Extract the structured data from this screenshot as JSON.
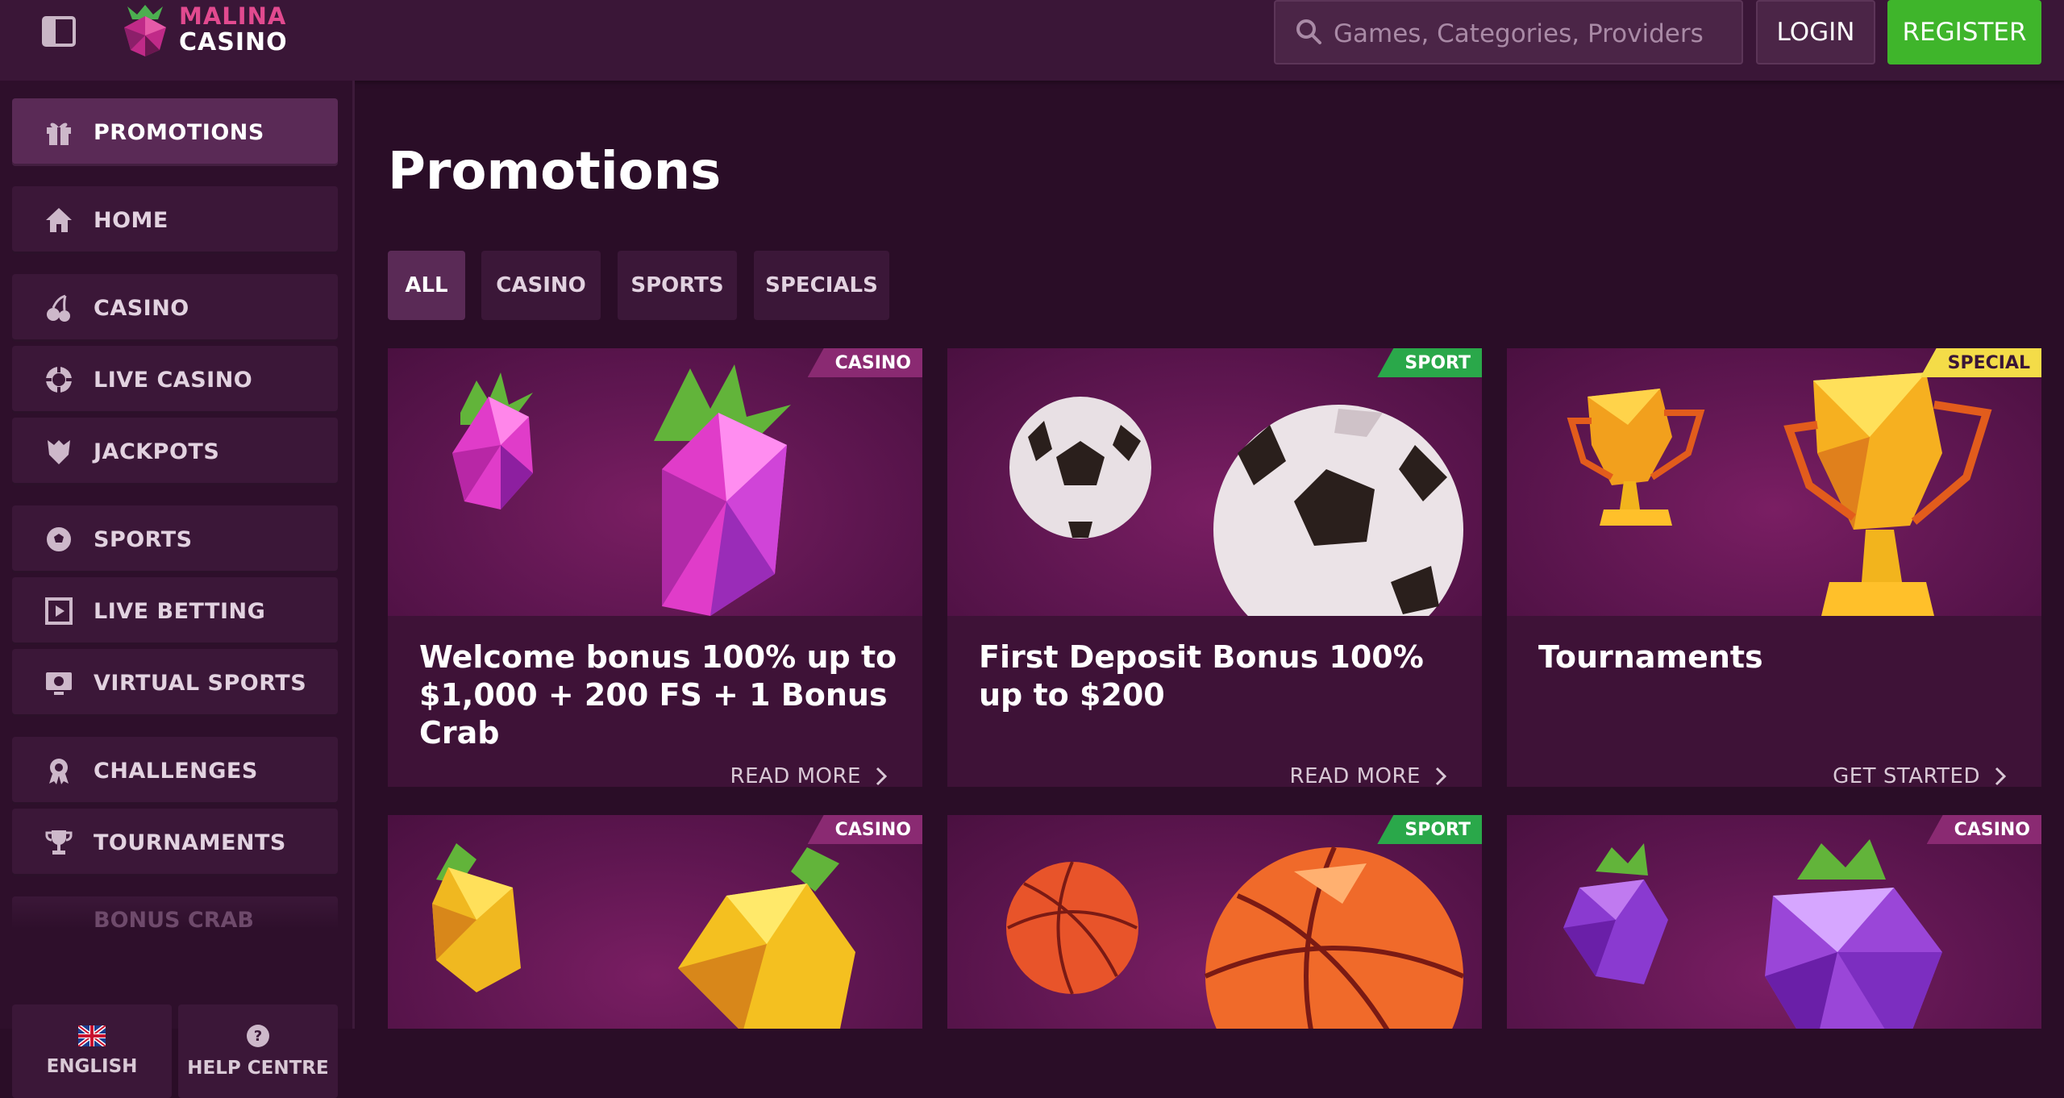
{
  "header": {
    "logo_line1": "MALINA",
    "logo_line2": "CASINO",
    "search_placeholder": "Games, Categories, Providers",
    "login_label": "LOGIN",
    "register_label": "REGISTER"
  },
  "sidebar": {
    "items": [
      {
        "label": "PROMOTIONS",
        "icon": "gift-icon",
        "active": true
      },
      {
        "label": "HOME",
        "icon": "home-icon"
      },
      {
        "label": "CASINO",
        "icon": "cherries-icon"
      },
      {
        "label": "LIVE CASINO",
        "icon": "chip-icon"
      },
      {
        "label": "JACKPOTS",
        "icon": "jackpot-icon"
      },
      {
        "label": "SPORTS",
        "icon": "soccer-ball-icon"
      },
      {
        "label": "LIVE BETTING",
        "icon": "live-play-icon"
      },
      {
        "label": "VIRTUAL SPORTS",
        "icon": "virtual-screen-icon"
      },
      {
        "label": "CHALLENGES",
        "icon": "medal-icon"
      },
      {
        "label": "TOURNAMENTS",
        "icon": "trophy-icon"
      }
    ],
    "partial_item": "BONUS CRAB",
    "language_label": "ENGLISH",
    "help_label": "HELP CENTRE"
  },
  "main": {
    "title": "Promotions",
    "tabs": [
      "ALL",
      "CASINO",
      "SPORTS",
      "SPECIALS"
    ],
    "cards": [
      {
        "tag": "CASINO",
        "title": "Welcome bonus 100% up to $1,000 + 200 FS + 1 Bonus Crab",
        "cta": "READ MORE",
        "art": "raspberry"
      },
      {
        "tag": "SPORT",
        "title": "First Deposit Bonus 100% up to $200",
        "cta": "READ MORE",
        "art": "soccer-ball"
      },
      {
        "tag": "SPECIAL",
        "title": "Tournaments",
        "cta": "GET STARTED",
        "art": "trophy"
      },
      {
        "tag": "CASINO",
        "art": "lemon"
      },
      {
        "tag": "SPORT",
        "art": "basketball"
      },
      {
        "tag": "CASINO",
        "art": "grapes"
      }
    ]
  },
  "colors": {
    "tag_casino": "#8a2a72",
    "tag_sport": "#2aa84a",
    "tag_special": "#f4dc48",
    "register": "#3fb52b",
    "brand_pink": "#e24a8f"
  }
}
